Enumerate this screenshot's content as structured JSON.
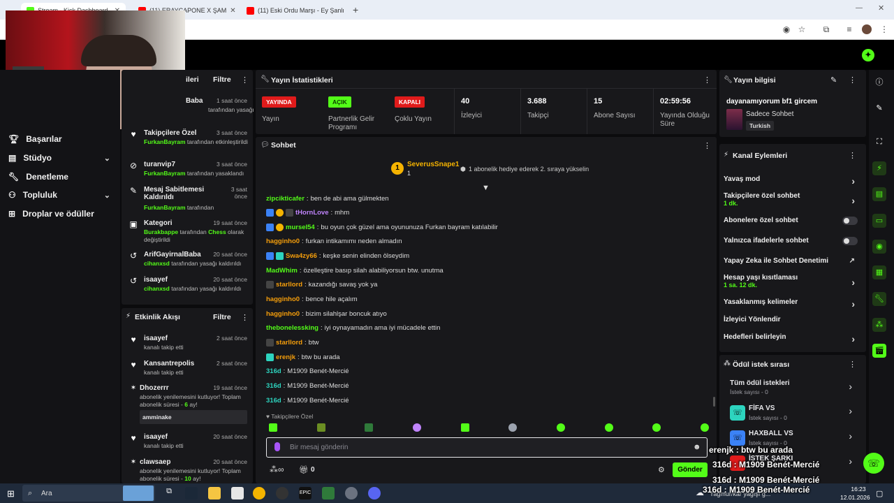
{
  "browser": {
    "tabs": [
      {
        "label": "Stream - Kick Dashboard",
        "color": "#53fc18"
      },
      {
        "label": "(11) ERAYCAPONE X ŞAM",
        "color": "#ff0000"
      },
      {
        "label": "(11) Eski Ordu Marşı - Ey Şanlı",
        "color": "#ff0000"
      }
    ],
    "new_tab": "+"
  },
  "nav": {
    "items": [
      {
        "label": "Başarılar",
        "icon": "trophy-icon"
      },
      {
        "label": "Stüdyo",
        "icon": "studio-icon",
        "chevron": "⌄"
      },
      {
        "label": "Denetleme",
        "icon": "wrench-icon"
      },
      {
        "label": "Topluluk",
        "icon": "community-icon",
        "chevron": "⌄"
      },
      {
        "label": "Droplar ve ödüller",
        "icon": "drops-icon"
      }
    ]
  },
  "modlog": {
    "title_fragment": "ileri",
    "filter": "Filtre",
    "entries": [
      {
        "title": "Baba",
        "time": "1 saat önce",
        "actor": "",
        "desc": "tarafından yasağı"
      },
      {
        "title": "Takipçilere Özel",
        "time": "3 saat önce",
        "actor": "FurkanBayram",
        "desc": "tarafından etkinleştirildi"
      },
      {
        "title": "turanvip7",
        "time": "3 saat önce",
        "actor": "FurkanBayram",
        "desc": "tarafından yasaklandı"
      },
      {
        "title": "Mesaj Sabitlemesi Kaldırıldı",
        "time": "3 saat önce",
        "actor": "FurkanBayram",
        "desc": "tarafından"
      },
      {
        "title": "Kategori",
        "time": "19 saat önce",
        "actor": "Burakbappe",
        "desc": "tarafından",
        "extra_user": "Chess",
        "extra": "olarak değiştirildi"
      },
      {
        "title": "ArifGayirnalBaba",
        "time": "20 saat önce",
        "actor": "cihanxsd",
        "desc": "tarafından yasağı kaldırıldı"
      },
      {
        "title": "isaayef",
        "time": "20 saat önce",
        "actor": "cihanxsd",
        "desc": "tarafından yasağı kaldırıldı"
      }
    ]
  },
  "activity": {
    "title": "Etkinlik Akışı",
    "filter": "Filtre",
    "entries": [
      {
        "name": "isaayef",
        "time": "2 saat önce",
        "desc": "kanalı takip etti"
      },
      {
        "name": "Kansantrepolis",
        "time": "2 saat önce",
        "desc": "kanalı takip etti"
      },
      {
        "name": "Dhozerrr",
        "time": "19 saat önce",
        "desc": "abonelik yenilemesini kutluyor! Toplam abonelik süresi -",
        "months": "6",
        "months_suffix": "ay!",
        "message": "amminake"
      },
      {
        "name": "isaayef",
        "time": "20 saat önce",
        "desc": "kanalı takip etti"
      },
      {
        "name": "clawsaep",
        "time": "20 saat önce",
        "desc": "abonelik yenilemesini kutluyor! Toplam abonelik süresi -",
        "months": "10",
        "months_suffix": "ay!"
      }
    ]
  },
  "stats": {
    "title": "Yayın İstatistikleri",
    "items": [
      {
        "badge": "YAYINDA",
        "label": "Yayın",
        "badge_color": "#e01b1b"
      },
      {
        "badge": "AÇIK",
        "label": "Partnerlik Gelir Programı",
        "badge_color": "#53fc18"
      },
      {
        "badge": "KAPALI",
        "label": "Çoklu Yayın",
        "badge_color": "#e01b1b"
      },
      {
        "value": "40",
        "label": "İzleyici"
      },
      {
        "value": "3.688",
        "label": "Takipçi"
      },
      {
        "value": "15",
        "label": "Abone Sayısı"
      },
      {
        "value": "02:59:56",
        "label": "Yayında Olduğu Süre"
      }
    ]
  },
  "chat": {
    "title": "Sohbet",
    "pinned": {
      "user": "SeverusSnape1",
      "count": "1",
      "text": "1 abonelik hediye ederek 2. sıraya yükselin"
    },
    "messages": [
      {
        "user": "zipcikticafer",
        "color": "#53fc18",
        "text": "ben de abi ama gülmekten"
      },
      {
        "user": "tHornLove",
        "color": "#c084fc",
        "text": "mhm"
      },
      {
        "user": "mursel54",
        "color": "#53fc18",
        "text": "bu oyun çok güzel ama oyununuza Furkan bayram katılabilir"
      },
      {
        "user": "hagginho0",
        "color": "#f59e0b",
        "text": "furkan intikamımı neden almadın"
      },
      {
        "user": "Swa4zy66",
        "color": "#f59e0b",
        "text": "keşke senin elinden ölseydim"
      },
      {
        "user": "MadWhim",
        "color": "#53fc18",
        "text": "özelleştire basıp silah alabiliyorsun btw. unutma"
      },
      {
        "user": "starllord",
        "color": "#f59e0b",
        "text": "kazandığı savaş yok ya"
      },
      {
        "user": "hagginho0",
        "color": "#f59e0b",
        "text": "bence hile açalım"
      },
      {
        "user": "hagginho0",
        "color": "#f59e0b",
        "text": "bizim silahlşar boncuk atıyo"
      },
      {
        "user": "thebonelessking",
        "color": "#53fc18",
        "text": "iyi oynayamadın ama iyi mücadele ettin"
      },
      {
        "user": "starllord",
        "color": "#f59e0b",
        "text": "btw"
      },
      {
        "user": "erenjk",
        "color": "#f59e0b",
        "text": "btw bu arada"
      },
      {
        "user": "316d",
        "color": "#2dd4bf",
        "text": "M1909 Benét-Mercié"
      },
      {
        "user": "316d",
        "color": "#2dd4bf",
        "text": "M1909 Benét-Mercié"
      },
      {
        "user": "316d",
        "color": "#2dd4bf",
        "text": "M1909 Benét-Mercié"
      }
    ],
    "followers_only": "Takipçilere Özel",
    "input_placeholder": "Bir mesaj gönderin",
    "points": "0",
    "send": "Gönder"
  },
  "info": {
    "title": "Yayın bilgisi",
    "stream_title": "dayanamıyorum bf1 gircem",
    "category": "Sadece Sohbet",
    "language": "Turkish"
  },
  "channel_actions": {
    "title": "Kanal Eylemleri",
    "items": [
      {
        "label": "Yavaş mod",
        "type": "chevron"
      },
      {
        "label": "Takipçilere özel sohbet",
        "sub": "1 dk.",
        "type": "chevron"
      },
      {
        "label": "Abonelere özel sohbet",
        "type": "toggle"
      },
      {
        "label": "Yalnızca ifadelerle sohbet",
        "type": "toggle"
      },
      {
        "label": "Yapay Zeka ile Sohbet Denetimi",
        "type": "external"
      },
      {
        "label": "Hesap yaşı kısıtlaması",
        "sub": "1 sa. 12 dk.",
        "type": "chevron"
      },
      {
        "label": "Yasaklanmış kelimeler",
        "type": "chevron"
      },
      {
        "label": "İzleyici Yönlendir",
        "type": "none"
      },
      {
        "label": "Hedefleri belirleyin",
        "type": "chevron"
      }
    ]
  },
  "rewards": {
    "title": "Ödül istek sırası",
    "items": [
      {
        "label": "Tüm ödül istekleri",
        "sub": "İstek sayısı - 0"
      },
      {
        "label": "FİFA VS",
        "sub": "İstek sayısı - 0"
      },
      {
        "label": "HAXBALL VS",
        "sub": "İstek sayısı - 0"
      },
      {
        "label": "İSTEK ŞARKI",
        "sub": ""
      }
    ]
  },
  "overlay": {
    "lines": [
      "erenjk : btw bu arada",
      "316d : M1909 Benét-Mercié",
      "316d : M1909 Benét-Mercié",
      "316d : M1909 Benét-Mercié"
    ]
  },
  "taskbar": {
    "search": "Ara",
    "weather": "Yağmur/kar yağışı g...",
    "time": "16:23",
    "date": "12.01.2026"
  },
  "colors": {
    "accent": "#53fc18",
    "bg": "#0b0b0d",
    "panel": "#18181b"
  }
}
